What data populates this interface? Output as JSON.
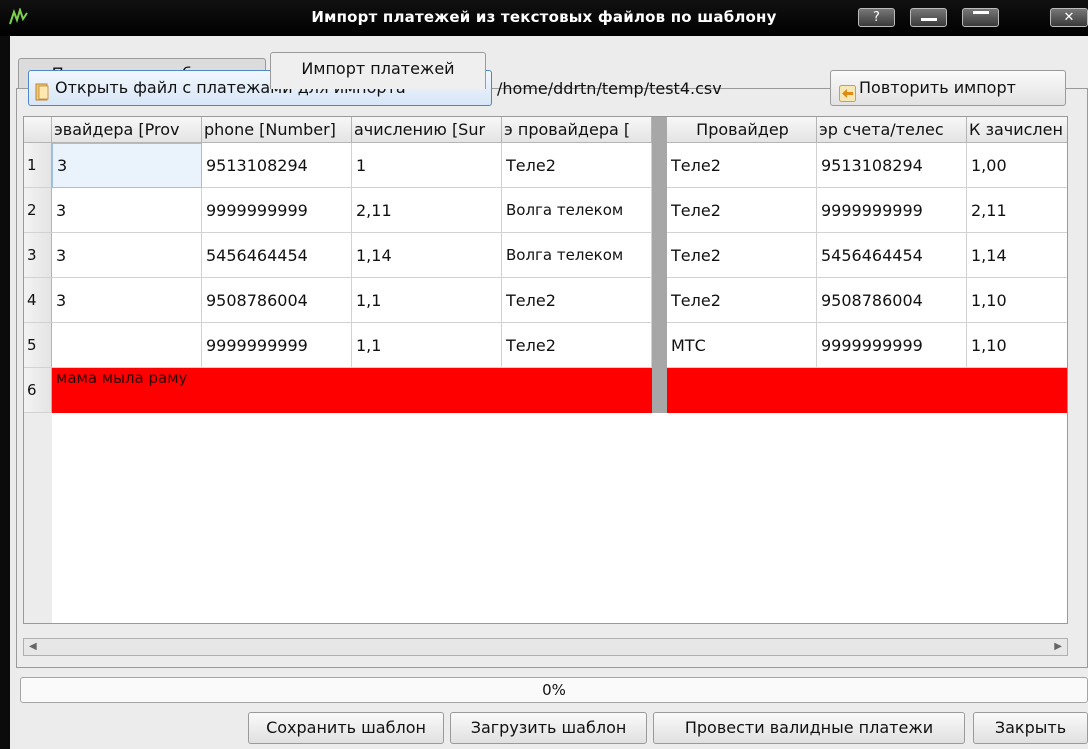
{
  "window": {
    "title": "Импорт платежей из текстовых файлов по шаблону",
    "app_icon": "tree-icon",
    "controls": {
      "help": "?",
      "minimize": "—",
      "maximize": "▭",
      "close": "✕"
    }
  },
  "tabs": [
    {
      "label": "Парам етры шаблона",
      "active": false
    },
    {
      "label": "Импорт платежей",
      "active": true
    }
  ],
  "toolbar": {
    "open_file_label": "Открыть файл с платежами для импорта",
    "file_path": "/home/ddrtn/temp/test4.csv",
    "repeat_import_label": "Повторить импорт"
  },
  "table": {
    "headers": [
      "эвайдера [Prov",
      "phone [Number]",
      "ачислению [Sur",
      "э провайдера [",
      "Провайдер",
      "эр счета/телес",
      "К зачислен"
    ],
    "row_numbers": [
      "1",
      "2",
      "3",
      "4",
      "5",
      "6"
    ],
    "rows": [
      [
        "3",
        "9513108294",
        "1",
        "Теле2",
        "Теле2",
        "9513108294",
        "1,00"
      ],
      [
        "3",
        "9999999999",
        "2,11",
        "Волга телеком",
        "Теле2",
        "9999999999",
        "2,11"
      ],
      [
        "3",
        "5456464454",
        "1,14",
        "Волга телеком",
        "Теле2",
        "5456464454",
        "1,14"
      ],
      [
        "3",
        "9508786004",
        "1,1",
        "Теле2",
        "Теле2",
        "9508786004",
        "1,10"
      ],
      [
        "",
        "9999999999",
        "1,1",
        "Теле2",
        "МТС",
        "9999999999",
        "1,10"
      ],
      [
        "мама мыла раму",
        "",
        "",
        "",
        "",
        "",
        ""
      ]
    ],
    "error_row_color": "#ff0000"
  },
  "progress": {
    "text": "0%",
    "value": 0
  },
  "buttons": {
    "save_template": "Сохранить шаблон",
    "load_template": "Загрузить шаблон",
    "process_valid": "Провести валидные платежи",
    "close": "Закрыть"
  }
}
